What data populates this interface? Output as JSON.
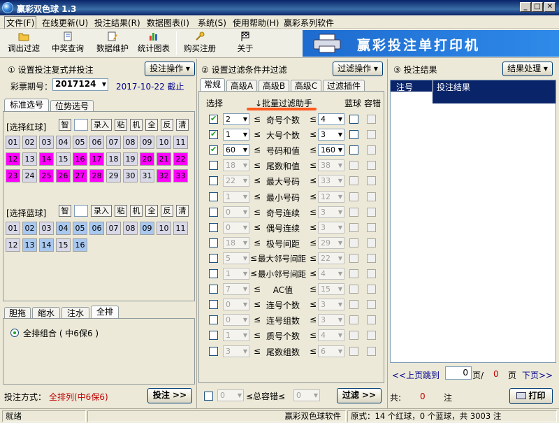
{
  "app": {
    "title": "赢彩双色球 1.3"
  },
  "menu": [
    "文件(F)",
    "在线更新(U)",
    "投注结果(R)",
    "数据图表(I)",
    "系统(S)",
    "使用帮助(H)",
    "赢彩系列软件"
  ],
  "toolbar": [
    "调出过滤",
    "中奖查询",
    "数据维护",
    "统计图表",
    "购买注册",
    "关于"
  ],
  "banner": {
    "text": "赢彩投注单打印机"
  },
  "left": {
    "section_title": "① 设置投注复式并投注",
    "ops_button": "投注操作",
    "issue_label": "彩票期号：",
    "issue_value": "2017124",
    "issue_date": "2017-10-22 截止",
    "tabs": [
      "标准选号",
      "位势选号"
    ],
    "red_label": "[选择红球]",
    "blue_label": "[选择蓝球]",
    "tools": [
      "智",
      "",
      "录入",
      "粘",
      "机",
      "全",
      "反",
      "清"
    ],
    "red_balls": [
      {
        "n": "01",
        "s": false
      },
      {
        "n": "02",
        "s": false
      },
      {
        "n": "03",
        "s": false
      },
      {
        "n": "04",
        "s": false
      },
      {
        "n": "05",
        "s": false
      },
      {
        "n": "06",
        "s": false
      },
      {
        "n": "07",
        "s": false
      },
      {
        "n": "08",
        "s": false
      },
      {
        "n": "09",
        "s": false
      },
      {
        "n": "10",
        "s": false
      },
      {
        "n": "11",
        "s": false
      },
      {
        "n": "12",
        "s": true
      },
      {
        "n": "13",
        "s": false
      },
      {
        "n": "14",
        "s": true
      },
      {
        "n": "15",
        "s": false
      },
      {
        "n": "16",
        "s": true
      },
      {
        "n": "17",
        "s": true
      },
      {
        "n": "18",
        "s": false
      },
      {
        "n": "19",
        "s": false
      },
      {
        "n": "20",
        "s": true
      },
      {
        "n": "21",
        "s": true
      },
      {
        "n": "22",
        "s": true
      },
      {
        "n": "23",
        "s": true
      },
      {
        "n": "24",
        "s": false
      },
      {
        "n": "25",
        "s": true
      },
      {
        "n": "26",
        "s": true
      },
      {
        "n": "27",
        "s": true
      },
      {
        "n": "28",
        "s": true
      },
      {
        "n": "29",
        "s": false
      },
      {
        "n": "30",
        "s": false
      },
      {
        "n": "31",
        "s": false
      },
      {
        "n": "32",
        "s": true
      },
      {
        "n": "33",
        "s": true
      }
    ],
    "blue_balls": [
      {
        "n": "01",
        "s": false
      },
      {
        "n": "02",
        "s": true
      },
      {
        "n": "03",
        "s": false
      },
      {
        "n": "04",
        "s": true
      },
      {
        "n": "05",
        "s": true
      },
      {
        "n": "06",
        "s": true
      },
      {
        "n": "07",
        "s": false
      },
      {
        "n": "08",
        "s": false
      },
      {
        "n": "09",
        "s": true
      },
      {
        "n": "10",
        "s": false
      },
      {
        "n": "11",
        "s": false
      },
      {
        "n": "12",
        "s": false
      },
      {
        "n": "13",
        "s": true
      },
      {
        "n": "14",
        "s": true
      },
      {
        "n": "15",
        "s": false
      },
      {
        "n": "16",
        "s": true
      }
    ],
    "mode_tabs": [
      "胆拖",
      "缩水",
      "注水",
      "全排"
    ],
    "radio_label": "全排组合 ( 中6保6 )",
    "bet_method_label": "投注方式：",
    "bet_method_value": "全排列(中6保6)",
    "bet_button": "投注 >>"
  },
  "middle": {
    "section_title": "② 设置过滤条件并过滤",
    "ops_button": "过滤操作",
    "tabs": [
      "常规",
      "高级A",
      "高级B",
      "高级C",
      "过滤插件"
    ],
    "col_select": "选择",
    "col_helper": "↓批量过滤助手",
    "col_blue": "蓝球",
    "col_tolerance": "容错",
    "rows": [
      {
        "checked": true,
        "enabled": true,
        "min": "2",
        "label": "奇号个数",
        "max": "4"
      },
      {
        "checked": true,
        "enabled": true,
        "min": "1",
        "label": "大号个数",
        "max": "3"
      },
      {
        "checked": true,
        "enabled": true,
        "min": "60",
        "label": "号码和值",
        "max": "160"
      },
      {
        "checked": false,
        "enabled": false,
        "min": "18",
        "label": "尾数和值",
        "max": "38"
      },
      {
        "checked": false,
        "enabled": false,
        "min": "22",
        "label": "最大号码",
        "max": "33"
      },
      {
        "checked": false,
        "enabled": false,
        "min": "1",
        "label": "最小号码",
        "max": "12"
      },
      {
        "checked": false,
        "enabled": false,
        "min": "0",
        "label": "奇号连续",
        "max": "3"
      },
      {
        "checked": false,
        "enabled": false,
        "min": "0",
        "label": "偶号连续",
        "max": "3"
      },
      {
        "checked": false,
        "enabled": false,
        "min": "18",
        "label": "极号间距",
        "max": "29"
      },
      {
        "checked": false,
        "enabled": false,
        "min": "5",
        "label": "最大邻号间距",
        "max": "22"
      },
      {
        "checked": false,
        "enabled": false,
        "min": "1",
        "label": "最小邻号间距",
        "max": "4"
      },
      {
        "checked": false,
        "enabled": false,
        "min": "7",
        "label": "AC值",
        "max": "15"
      },
      {
        "checked": false,
        "enabled": false,
        "min": "0",
        "label": "连号个数",
        "max": "3"
      },
      {
        "checked": false,
        "enabled": false,
        "min": "0",
        "label": "连号组数",
        "max": "3"
      },
      {
        "checked": false,
        "enabled": false,
        "min": "1",
        "label": "质号个数",
        "max": "4"
      },
      {
        "checked": false,
        "enabled": false,
        "min": "3",
        "label": "尾数组数",
        "max": "6"
      }
    ],
    "lte": "≤",
    "total_label": "≤总容错≤",
    "total_min": "0",
    "total_max": "0",
    "filter_button": "过滤 >>"
  },
  "right": {
    "section_title": "③ 投注结果",
    "ops_button": "结果处理",
    "col_no": "注号",
    "col_result": "投注结果",
    "prev": "<<上页",
    "jump": "跳到",
    "page_value": "0",
    "page_sep": "页/",
    "page_total": "0",
    "page_suffix": "页",
    "next": "下页>>",
    "total_label": "共:",
    "total_value": "0",
    "total_unit": "注",
    "print_button": "打印"
  },
  "status": {
    "left": "就绪",
    "center": "赢彩双色球软件",
    "right": "原式：14 个红球，0 个蓝球，共 3003 注"
  }
}
